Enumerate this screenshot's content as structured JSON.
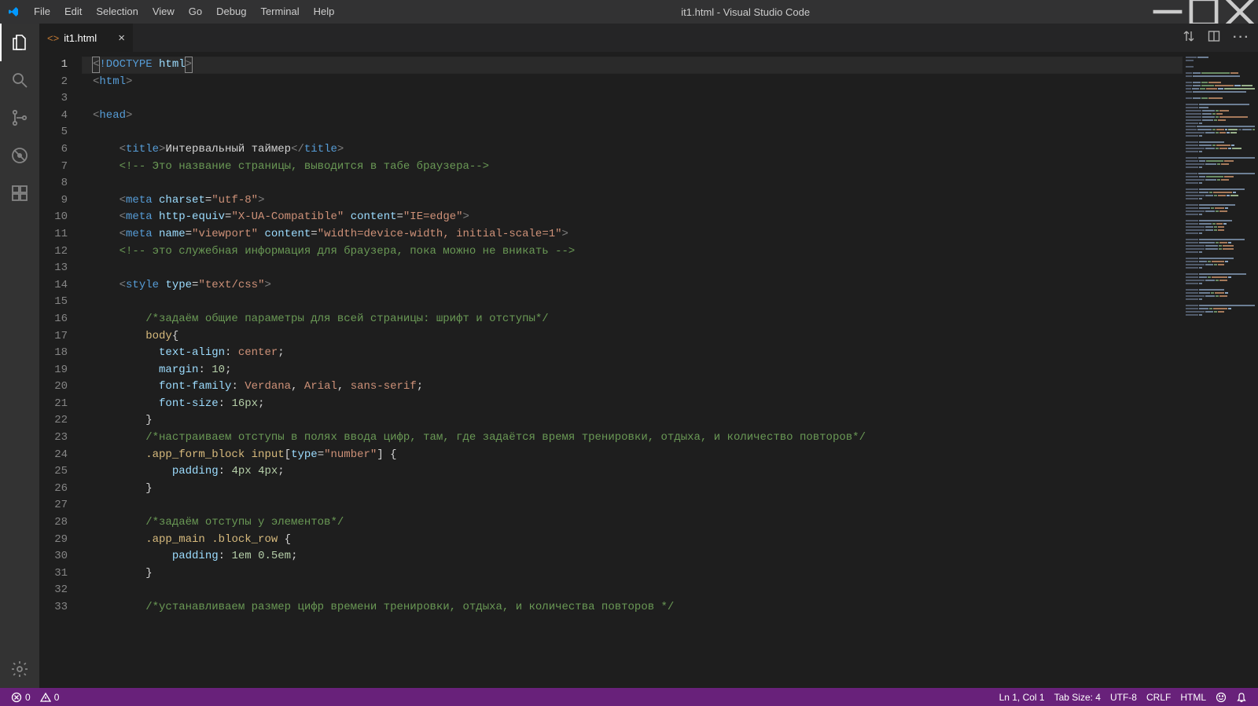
{
  "window": {
    "title": "it1.html - Visual Studio Code",
    "menu": [
      "File",
      "Edit",
      "Selection",
      "View",
      "Go",
      "Debug",
      "Terminal",
      "Help"
    ]
  },
  "tabs": [
    {
      "icon": "<>",
      "label": "it1.html"
    }
  ],
  "code_lines": [
    [
      {
        "t": "<",
        "c": "c-gray",
        "hl": true
      },
      {
        "t": "!DOCTYPE ",
        "c": "c-blue"
      },
      {
        "t": "html",
        "c": "c-attr"
      },
      {
        "t": ">",
        "c": "c-gray",
        "hl": true
      }
    ],
    [
      {
        "t": "<",
        "c": "c-gray"
      },
      {
        "t": "html",
        "c": "c-blue"
      },
      {
        "t": ">",
        "c": "c-gray"
      }
    ],
    [],
    [
      {
        "t": "<",
        "c": "c-gray"
      },
      {
        "t": "head",
        "c": "c-blue"
      },
      {
        "t": ">",
        "c": "c-gray"
      }
    ],
    [],
    [
      {
        "t": "    ",
        "c": "c-text"
      },
      {
        "t": "<",
        "c": "c-gray"
      },
      {
        "t": "title",
        "c": "c-blue"
      },
      {
        "t": ">",
        "c": "c-gray"
      },
      {
        "t": "Интервальный таймер",
        "c": "c-text"
      },
      {
        "t": "</",
        "c": "c-gray"
      },
      {
        "t": "title",
        "c": "c-blue"
      },
      {
        "t": ">",
        "c": "c-gray"
      }
    ],
    [
      {
        "t": "    ",
        "c": "c-text"
      },
      {
        "t": "<!-- Это название страницы, выводится в табе браузера-->",
        "c": "c-cmt"
      }
    ],
    [],
    [
      {
        "t": "    ",
        "c": "c-text"
      },
      {
        "t": "<",
        "c": "c-gray"
      },
      {
        "t": "meta ",
        "c": "c-blue"
      },
      {
        "t": "charset",
        "c": "c-attr"
      },
      {
        "t": "=",
        "c": "c-text"
      },
      {
        "t": "\"utf-8\"",
        "c": "c-str"
      },
      {
        "t": ">",
        "c": "c-gray"
      }
    ],
    [
      {
        "t": "    ",
        "c": "c-text"
      },
      {
        "t": "<",
        "c": "c-gray"
      },
      {
        "t": "meta ",
        "c": "c-blue"
      },
      {
        "t": "http-equiv",
        "c": "c-attr"
      },
      {
        "t": "=",
        "c": "c-text"
      },
      {
        "t": "\"X-UA-Compatible\"",
        "c": "c-str"
      },
      {
        "t": " ",
        "c": "c-text"
      },
      {
        "t": "content",
        "c": "c-attr"
      },
      {
        "t": "=",
        "c": "c-text"
      },
      {
        "t": "\"IE=edge\"",
        "c": "c-str"
      },
      {
        "t": ">",
        "c": "c-gray"
      }
    ],
    [
      {
        "t": "    ",
        "c": "c-text"
      },
      {
        "t": "<",
        "c": "c-gray"
      },
      {
        "t": "meta ",
        "c": "c-blue"
      },
      {
        "t": "name",
        "c": "c-attr"
      },
      {
        "t": "=",
        "c": "c-text"
      },
      {
        "t": "\"viewport\"",
        "c": "c-str"
      },
      {
        "t": " ",
        "c": "c-text"
      },
      {
        "t": "content",
        "c": "c-attr"
      },
      {
        "t": "=",
        "c": "c-text"
      },
      {
        "t": "\"width=device-width, initial-scale=1\"",
        "c": "c-str"
      },
      {
        "t": ">",
        "c": "c-gray"
      }
    ],
    [
      {
        "t": "    ",
        "c": "c-text"
      },
      {
        "t": "<!-- это служебная информация для браузера, пока можно не вникать -->",
        "c": "c-cmt"
      }
    ],
    [],
    [
      {
        "t": "    ",
        "c": "c-text"
      },
      {
        "t": "<",
        "c": "c-gray"
      },
      {
        "t": "style ",
        "c": "c-blue"
      },
      {
        "t": "type",
        "c": "c-attr"
      },
      {
        "t": "=",
        "c": "c-text"
      },
      {
        "t": "\"text/css\"",
        "c": "c-str"
      },
      {
        "t": ">",
        "c": "c-gray"
      }
    ],
    [],
    [
      {
        "t": "        ",
        "c": "c-text"
      },
      {
        "t": "/*задаём общие параметры для всей страницы: шрифт и отступы*/",
        "c": "c-cmt"
      }
    ],
    [
      {
        "t": "        ",
        "c": "c-text"
      },
      {
        "t": "body",
        "c": "c-selector"
      },
      {
        "t": "{",
        "c": "c-text"
      }
    ],
    [
      {
        "t": "          ",
        "c": "c-text"
      },
      {
        "t": "text-align",
        "c": "c-attr"
      },
      {
        "t": ": ",
        "c": "c-text"
      },
      {
        "t": "center",
        "c": "c-str"
      },
      {
        "t": ";",
        "c": "c-text"
      }
    ],
    [
      {
        "t": "          ",
        "c": "c-text"
      },
      {
        "t": "margin",
        "c": "c-attr"
      },
      {
        "t": ": ",
        "c": "c-text"
      },
      {
        "t": "10",
        "c": "c-num"
      },
      {
        "t": ";",
        "c": "c-text"
      }
    ],
    [
      {
        "t": "          ",
        "c": "c-text"
      },
      {
        "t": "font-family",
        "c": "c-attr"
      },
      {
        "t": ": ",
        "c": "c-text"
      },
      {
        "t": "Verdana",
        "c": "c-str"
      },
      {
        "t": ", ",
        "c": "c-text"
      },
      {
        "t": "Arial",
        "c": "c-str"
      },
      {
        "t": ", ",
        "c": "c-text"
      },
      {
        "t": "sans-serif",
        "c": "c-str"
      },
      {
        "t": ";",
        "c": "c-text"
      }
    ],
    [
      {
        "t": "          ",
        "c": "c-text"
      },
      {
        "t": "font-size",
        "c": "c-attr"
      },
      {
        "t": ": ",
        "c": "c-text"
      },
      {
        "t": "16px",
        "c": "c-num"
      },
      {
        "t": ";",
        "c": "c-text"
      }
    ],
    [
      {
        "t": "        ",
        "c": "c-text"
      },
      {
        "t": "}",
        "c": "c-text"
      }
    ],
    [
      {
        "t": "        ",
        "c": "c-text"
      },
      {
        "t": "/*настраиваем отступы в полях ввода цифр, там, где задаётся время тренировки, отдыха, и количество повторов*/",
        "c": "c-cmt"
      }
    ],
    [
      {
        "t": "        ",
        "c": "c-text"
      },
      {
        "t": ".app_form_block",
        "c": "c-selector"
      },
      {
        "t": " ",
        "c": "c-text"
      },
      {
        "t": "input",
        "c": "c-selector"
      },
      {
        "t": "[",
        "c": "c-text"
      },
      {
        "t": "type",
        "c": "c-attr"
      },
      {
        "t": "=",
        "c": "c-text"
      },
      {
        "t": "\"number\"",
        "c": "c-str"
      },
      {
        "t": "] {",
        "c": "c-text"
      }
    ],
    [
      {
        "t": "            ",
        "c": "c-text"
      },
      {
        "t": "padding",
        "c": "c-attr"
      },
      {
        "t": ": ",
        "c": "c-text"
      },
      {
        "t": "4px",
        "c": "c-num"
      },
      {
        "t": " ",
        "c": "c-text"
      },
      {
        "t": "4px",
        "c": "c-num"
      },
      {
        "t": ";",
        "c": "c-text"
      }
    ],
    [
      {
        "t": "        ",
        "c": "c-text"
      },
      {
        "t": "}",
        "c": "c-text"
      }
    ],
    [],
    [
      {
        "t": "        ",
        "c": "c-text"
      },
      {
        "t": "/*задаём отступы у элементов*/",
        "c": "c-cmt"
      }
    ],
    [
      {
        "t": "        ",
        "c": "c-text"
      },
      {
        "t": ".app_main",
        "c": "c-selector"
      },
      {
        "t": " ",
        "c": "c-text"
      },
      {
        "t": ".block_row",
        "c": "c-selector"
      },
      {
        "t": " {",
        "c": "c-text"
      }
    ],
    [
      {
        "t": "            ",
        "c": "c-text"
      },
      {
        "t": "padding",
        "c": "c-attr"
      },
      {
        "t": ": ",
        "c": "c-text"
      },
      {
        "t": "1em",
        "c": "c-num"
      },
      {
        "t": " ",
        "c": "c-text"
      },
      {
        "t": "0.5em",
        "c": "c-num"
      },
      {
        "t": ";",
        "c": "c-text"
      }
    ],
    [
      {
        "t": "        ",
        "c": "c-text"
      },
      {
        "t": "}",
        "c": "c-text"
      }
    ],
    [],
    [
      {
        "t": "        ",
        "c": "c-text"
      },
      {
        "t": "/*устанавливаем размер цифр времени тренировки, отдыха, и количества повторов */",
        "c": "c-cmt"
      }
    ]
  ],
  "status": {
    "errors": "0",
    "warnings": "0",
    "cursor": "Ln 1, Col 1",
    "tabsize": "Tab Size: 4",
    "encoding": "UTF-8",
    "eol": "CRLF",
    "lang": "HTML"
  },
  "minimap_widths": [
    [
      14,
      14
    ],
    [
      10
    ],
    [
      0
    ],
    [
      10
    ],
    [
      0
    ],
    [
      8,
      10,
      36,
      10
    ],
    [
      8,
      60
    ],
    [
      0
    ],
    [
      8,
      10,
      8,
      16
    ],
    [
      8,
      10,
      16,
      24,
      8,
      14
    ],
    [
      8,
      10,
      8,
      16,
      8,
      44
    ],
    [
      8,
      68
    ],
    [
      0
    ],
    [
      8,
      10,
      8,
      18
    ],
    [
      0
    ],
    [
      16,
      64
    ],
    [
      16,
      12
    ],
    [
      20,
      16,
      4,
      12
    ],
    [
      20,
      12,
      4,
      8
    ],
    [
      20,
      16,
      4,
      36
    ],
    [
      20,
      14,
      4,
      10
    ],
    [
      16,
      4
    ],
    [
      16,
      90
    ],
    [
      16,
      22,
      4,
      12,
      4,
      14,
      4,
      14,
      4
    ],
    [
      24,
      12,
      4,
      8,
      4,
      8
    ],
    [
      16,
      4
    ],
    [
      0
    ],
    [
      16,
      32
    ],
    [
      16,
      16,
      4,
      18,
      4
    ],
    [
      24,
      12,
      4,
      10,
      4,
      12
    ],
    [
      16,
      4
    ],
    [
      0
    ],
    [
      16,
      80
    ],
    [
      16,
      8,
      22,
      12
    ],
    [
      24,
      14,
      4,
      10
    ],
    [
      16,
      4
    ],
    [
      0
    ],
    [
      16,
      80
    ],
    [
      16,
      8,
      22,
      12
    ],
    [
      24,
      14,
      4,
      10
    ],
    [
      16,
      4
    ],
    [
      0
    ],
    [
      16,
      58
    ],
    [
      16,
      12,
      4,
      24,
      4
    ],
    [
      24,
      10,
      4,
      10,
      4,
      10
    ],
    [
      16,
      4
    ],
    [
      0
    ],
    [
      16,
      46
    ],
    [
      16,
      14,
      4,
      12,
      4
    ],
    [
      24,
      12,
      4,
      10
    ],
    [
      16,
      4
    ],
    [
      0
    ],
    [
      16,
      42
    ],
    [
      16,
      16,
      4,
      8,
      4
    ],
    [
      24,
      10,
      4,
      8
    ],
    [
      24,
      10,
      4,
      8
    ],
    [
      16,
      4
    ],
    [
      0
    ],
    [
      16,
      58
    ],
    [
      16,
      20,
      4,
      10,
      4
    ],
    [
      24,
      16,
      4,
      14
    ],
    [
      24,
      16,
      4,
      14
    ],
    [
      16,
      4
    ],
    [
      0
    ],
    [
      16,
      44
    ],
    [
      16,
      10,
      4,
      16,
      4
    ],
    [
      24,
      10,
      4,
      8
    ],
    [
      16,
      4
    ],
    [
      0
    ],
    [
      16,
      60
    ],
    [
      16,
      10,
      4,
      20,
      4
    ],
    [
      24,
      12,
      4,
      10
    ],
    [
      16,
      4
    ],
    [
      0
    ],
    [
      16,
      32
    ],
    [
      16,
      14,
      4,
      12,
      4
    ],
    [
      24,
      12,
      4,
      10
    ],
    [
      16,
      4
    ],
    [
      0
    ],
    [
      16,
      72
    ],
    [
      16,
      12,
      4,
      18,
      4
    ],
    [
      24,
      10,
      4,
      8
    ],
    [
      16,
      4
    ]
  ],
  "minimap_palette": [
    "#505a6a",
    "#6d7f95",
    "#6a8c64",
    "#a67a5b",
    "#8ca7c4",
    "#98b08a"
  ]
}
